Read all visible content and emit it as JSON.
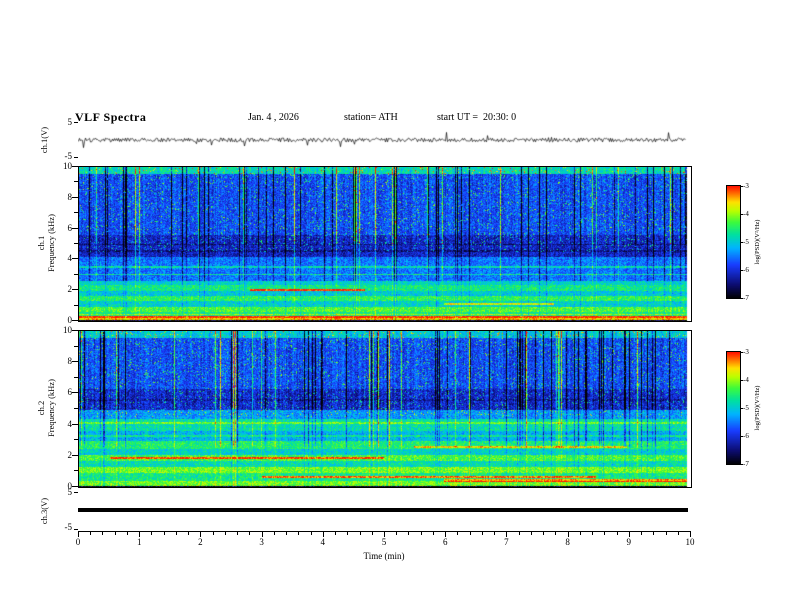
{
  "header": {
    "title": "VLF Spectra",
    "date": "Jan. 4 , 2026",
    "station": "station= ATH",
    "start_ut": "start UT =  20:30: 0"
  },
  "panels": {
    "wave1": {
      "label": "ch.1(V)",
      "ymax": "5",
      "ymin": "-5"
    },
    "spec1": {
      "channel": "ch.1",
      "ylabel": "Frequency (kHz)"
    },
    "spec2": {
      "channel": "ch.2",
      "ylabel": "Frequency (kHz)"
    },
    "wave3": {
      "label": "ch.3(V)",
      "ymax": "5",
      "ymin": "-5"
    }
  },
  "axes": {
    "freq_tick_labels": [
      "10",
      "8",
      "6",
      "4",
      "2",
      "0"
    ],
    "x_tick_labels": [
      "0",
      "1",
      "2",
      "3",
      "4",
      "5",
      "6",
      "7",
      "8",
      "9",
      "10"
    ],
    "x_label": "Time (min)"
  },
  "colorbar": {
    "label": "log(PSD)(V²/Hz)",
    "tick_labels": [
      "-3",
      "-4",
      "-5",
      "-6",
      "-7"
    ]
  },
  "chart_data": {
    "type": "heatmap",
    "title": "VLF Spectra",
    "date": "Jan. 4 , 2026",
    "station": "ATH",
    "start_ut": "20:30:0",
    "x": {
      "label": "Time (min)",
      "range": [
        0,
        10
      ],
      "ticks": [
        0,
        1,
        2,
        3,
        4,
        5,
        6,
        7,
        8,
        9,
        10
      ],
      "data_end_min": 9.8
    },
    "panels": [
      {
        "id": "ch1_waveform",
        "type": "line",
        "ylabel": "ch.1(V)",
        "yrange": [
          -5,
          5
        ],
        "summary": "broadband noise near 0 V with random impulsive spikes over the full 10 min"
      },
      {
        "id": "ch1_spectrogram",
        "type": "heatmap",
        "ylabel": "Frequency (kHz)",
        "yrange": [
          0,
          10
        ],
        "zlabel": "log(PSD)(V²/Hz)",
        "zrange": [
          -7,
          -3
        ],
        "summary": "blue background near -6 with dense green speckle and vertical sferic streaks above 5 kHz, darker quiet band 4.2-5.6 kHz, horizontal green/yellow power-line stripes below 2.6 kHz, bright red band near 0.2-0.4 kHz, black edge at 0 kHz, yellow-green strip at 10 kHz"
      },
      {
        "id": "ch2_spectrogram",
        "type": "heatmap",
        "ylabel": "Frequency (kHz)",
        "yrange": [
          0,
          10
        ],
        "zlabel": "log(PSD)(V²/Hz)",
        "zrange": [
          -7,
          -3
        ],
        "summary": "similar to ch.1 but dark quiet band 5-6.3 kHz and denser green/yellow stripes with red segments below 5 kHz"
      },
      {
        "id": "ch3_waveform",
        "type": "line",
        "ylabel": "ch.3(V)",
        "yrange": [
          -5,
          5
        ],
        "summary": "constant flat thick line at 0 V (no signal)"
      }
    ],
    "seed": 42,
    "colormap_stops": [
      [
        0,
        0,
        0,
        0
      ],
      [
        0.12,
        12,
        12,
        110
      ],
      [
        0.3,
        25,
        60,
        255
      ],
      [
        0.45,
        0,
        180,
        255
      ],
      [
        0.57,
        0,
        225,
        160
      ],
      [
        0.68,
        60,
        250,
        60
      ],
      [
        0.78,
        185,
        255,
        0
      ],
      [
        0.86,
        255,
        225,
        0
      ],
      [
        0.93,
        255,
        120,
        0
      ],
      [
        1,
        255,
        20,
        0
      ]
    ],
    "render": {
      "spec1": {
        "profile": [
          [
            0,
            0.12,
            0.05
          ],
          [
            0.12,
            0.35,
            0.88
          ],
          [
            0.35,
            0.6,
            0.6
          ],
          [
            0.6,
            0.95,
            0.68
          ],
          [
            0.95,
            1.3,
            0.52
          ],
          [
            1.3,
            1.65,
            0.64
          ],
          [
            1.65,
            2.0,
            0.5
          ],
          [
            2.0,
            2.35,
            0.6
          ],
          [
            2.35,
            2.6,
            0.52
          ],
          [
            2.6,
            4.2,
            0.37
          ],
          [
            4.2,
            5.6,
            0.22
          ],
          [
            5.6,
            9.6,
            0.31
          ],
          [
            9.6,
            10.1,
            0.55
          ]
        ],
        "lines": [
          [
            3.05,
            0.22,
            0.05
          ],
          [
            3.55,
            0.18,
            0.05
          ],
          [
            4.6,
            -0.08,
            0.07
          ],
          [
            5.0,
            -0.08,
            0.05
          ],
          [
            0.45,
            0.15,
            0.06
          ]
        ],
        "segments": [
          [
            2.05,
            0.28,
            0.47,
            0.4,
            0.06
          ],
          [
            1.15,
            0.6,
            0.78,
            0.3,
            0.06
          ],
          [
            0.3,
            0.0,
            1.0,
            0.12,
            0.08
          ]
        ]
      },
      "spec2": {
        "profile": [
          [
            0,
            0.12,
            0.05
          ],
          [
            0.12,
            0.4,
            0.72
          ],
          [
            0.4,
            0.9,
            0.6
          ],
          [
            0.9,
            1.3,
            0.72
          ],
          [
            1.3,
            1.7,
            0.55
          ],
          [
            1.7,
            2.1,
            0.68
          ],
          [
            2.1,
            2.5,
            0.52
          ],
          [
            2.5,
            3.0,
            0.62
          ],
          [
            3.0,
            3.6,
            0.46
          ],
          [
            3.6,
            4.4,
            0.56
          ],
          [
            4.4,
            5.0,
            0.42
          ],
          [
            5.0,
            6.3,
            0.23
          ],
          [
            6.3,
            9.6,
            0.31
          ],
          [
            9.6,
            10.1,
            0.5
          ]
        ],
        "lines": [
          [
            4.15,
            0.15,
            0.06
          ],
          [
            3.3,
            0.12,
            0.05
          ],
          [
            5.6,
            -0.06,
            0.08
          ]
        ],
        "segments": [
          [
            1.9,
            0.05,
            0.5,
            0.3,
            0.06
          ],
          [
            0.7,
            0.3,
            0.85,
            0.35,
            0.06
          ],
          [
            2.6,
            0.55,
            0.9,
            0.25,
            0.05
          ],
          [
            0.45,
            0.6,
            1.0,
            0.3,
            0.07
          ]
        ]
      }
    }
  }
}
